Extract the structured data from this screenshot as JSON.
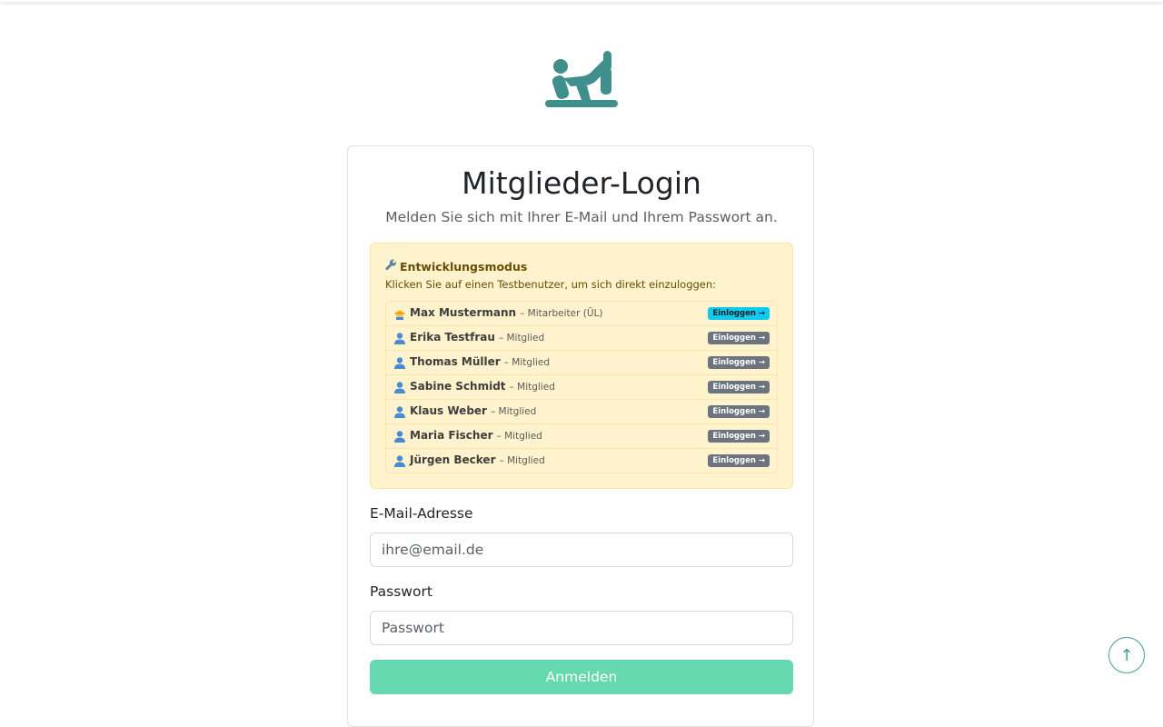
{
  "header": {
    "logo_icon": "stretching-person-icon"
  },
  "login": {
    "title": "Mitglieder-Login",
    "subtitle": "Melden Sie sich mit Ihrer E-Mail und Ihrem Passwort an."
  },
  "dev_mode": {
    "icon": "wrench-icon",
    "heading": "Entwicklungsmodus",
    "text": "Klicken Sie auf einen Testbenutzer, um sich direkt einzuloggen:",
    "users": [
      {
        "icon": "construction-worker-icon",
        "name": "Max Mustermann",
        "role": "– Mitarbeiter (ÜL)",
        "button": "Einloggen →",
        "style": "primary"
      },
      {
        "icon": "user-icon",
        "name": "Erika Testfrau",
        "role": "– Mitglied",
        "button": "Einloggen →",
        "style": "secondary"
      },
      {
        "icon": "user-icon",
        "name": "Thomas Müller",
        "role": "– Mitglied",
        "button": "Einloggen →",
        "style": "secondary"
      },
      {
        "icon": "user-icon",
        "name": "Sabine Schmidt",
        "role": "– Mitglied",
        "button": "Einloggen →",
        "style": "secondary"
      },
      {
        "icon": "user-icon",
        "name": "Klaus Weber",
        "role": "– Mitglied",
        "button": "Einloggen →",
        "style": "secondary"
      },
      {
        "icon": "user-icon",
        "name": "Maria Fischer",
        "role": "– Mitglied",
        "button": "Einloggen →",
        "style": "secondary"
      },
      {
        "icon": "user-icon",
        "name": "Jürgen Becker",
        "role": "– Mitglied",
        "button": "Einloggen →",
        "style": "secondary"
      }
    ]
  },
  "form": {
    "email_label": "E-Mail-Adresse",
    "email_value": "",
    "email_placeholder": "ihre@email.de",
    "password_label": "Passwort",
    "password_value": "",
    "password_placeholder": "Passwort",
    "submit_label": "Anmelden"
  },
  "scroll_top": {
    "icon": "arrow-up-icon",
    "glyph": "↑"
  },
  "colors": {
    "brand": "#3f8f8c",
    "submit": "#66d9b1",
    "dev_bg": "#fff3cd",
    "primary_badge": "#0dcaf0",
    "secondary_badge": "#6c757d"
  }
}
